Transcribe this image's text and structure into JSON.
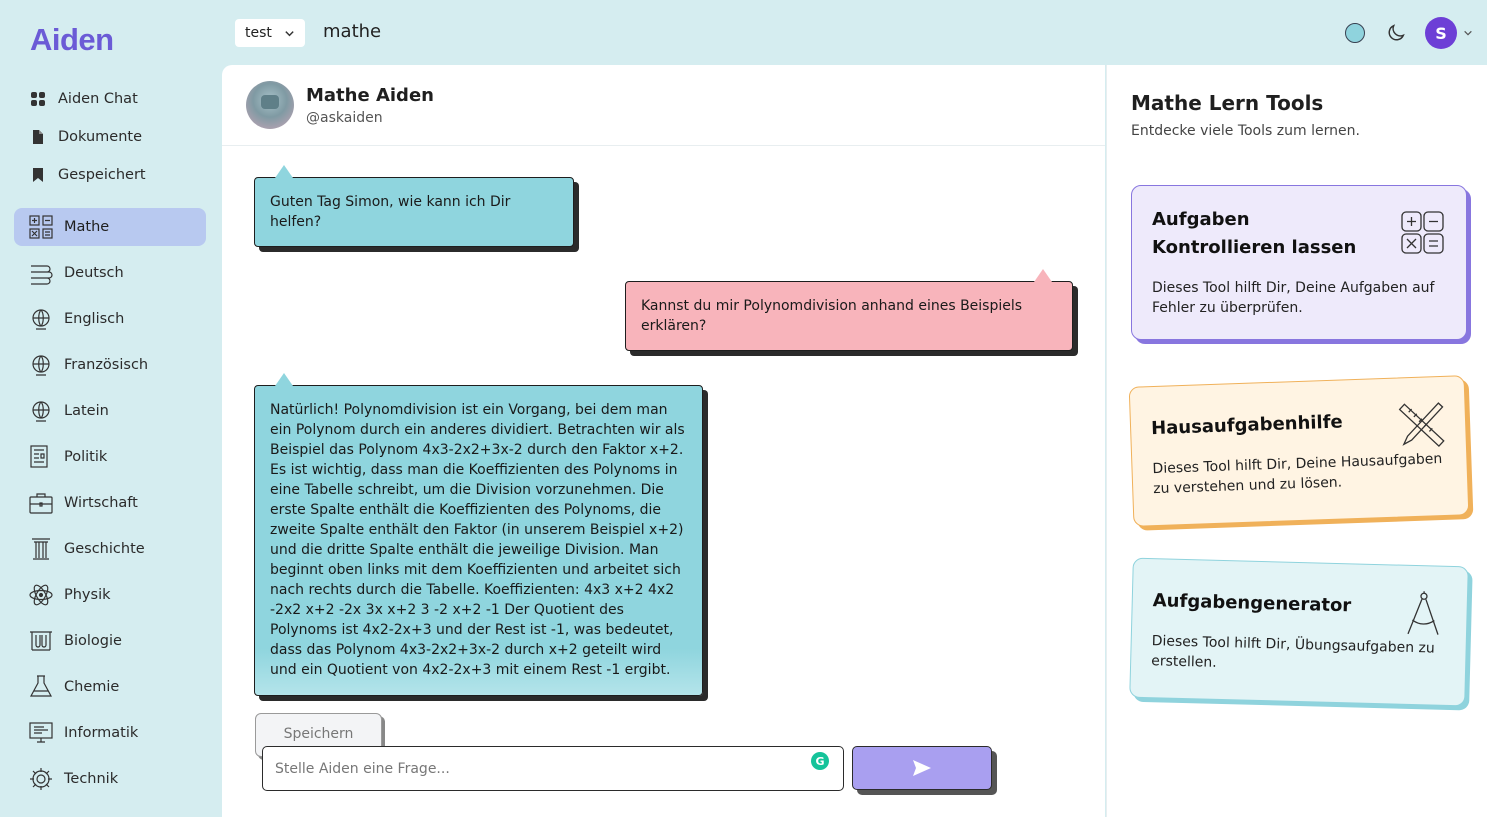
{
  "app": {
    "logo": "Aiden"
  },
  "topbar": {
    "workspace": "test",
    "page_title": "mathe",
    "user_initial": "S"
  },
  "sidebar": {
    "nav": [
      {
        "label": "Aiden Chat",
        "icon": "grid-icon"
      },
      {
        "label": "Dokumente",
        "icon": "document-icon"
      },
      {
        "label": "Gespeichert",
        "icon": "bookmark-icon"
      }
    ],
    "subjects": [
      {
        "label": "Mathe",
        "icon": "math-icon",
        "active": true
      },
      {
        "label": "Deutsch",
        "icon": "book-icon"
      },
      {
        "label": "Englisch",
        "icon": "globe-icon"
      },
      {
        "label": "Französisch",
        "icon": "globe-icon"
      },
      {
        "label": "Latein",
        "icon": "globe-icon"
      },
      {
        "label": "Politik",
        "icon": "newspaper-icon"
      },
      {
        "label": "Wirtschaft",
        "icon": "briefcase-icon"
      },
      {
        "label": "Geschichte",
        "icon": "column-icon"
      },
      {
        "label": "Physik",
        "icon": "atom-icon"
      },
      {
        "label": "Biologie",
        "icon": "lab-icon"
      },
      {
        "label": "Chemie",
        "icon": "flask-icon"
      },
      {
        "label": "Informatik",
        "icon": "monitor-icon"
      },
      {
        "label": "Technik",
        "icon": "gear-icon"
      }
    ]
  },
  "chat": {
    "bot_name": "Mathe Aiden",
    "bot_handle": "@askaiden",
    "messages": [
      {
        "role": "ai",
        "text": "Guten Tag Simon, wie kann ich Dir helfen?"
      },
      {
        "role": "user",
        "text": "Kannst du mir Polynomdivision anhand eines Beispiels erklären?"
      },
      {
        "role": "ai",
        "text": "Natürlich! Polynomdivision ist ein Vorgang, bei dem man ein Polynom durch ein anderes dividiert. Betrachten wir als Beispiel das Polynom 4x3-2x2+3x-2 durch den Faktor x+2. Es ist wichtig, dass man die Koeffizienten des Polynoms in eine Tabelle schreibt, um die Division vorzunehmen. Die erste Spalte enthält die Koeffizienten des Polynoms, die zweite Spalte enthält den Faktor (in unserem Beispiel x+2) und die dritte Spalte enthält die jeweilige Division. Man beginnt oben links mit dem Koeffizienten und arbeitet sich nach rechts durch die Tabelle. Koeffizienten: 4x3 x+2 4x2 -2x2 x+2 -2x 3x x+2 3 -2 x+2 -1 Der Quotient des Polynoms ist 4x2-2x+3 und der Rest ist -1, was bedeutet, dass das Polynom 4x3-2x2+3x-2 durch x+2 geteilt wird und ein Quotient von 4x2-2x+3 mit einem Rest -1 ergibt."
      }
    ],
    "save_label": "Speichern",
    "input_placeholder": "Stelle Aiden eine Frage..."
  },
  "tools": {
    "title": "Mathe Lern Tools",
    "subtitle": "Entdecke viele Tools zum lernen.",
    "cards": [
      {
        "title": "Aufgaben Kontrollieren lassen",
        "desc": "Dieses Tool hilft Dir, Deine Aufgaben auf Fehler zu überprüfen.",
        "icon": "calculator-icon",
        "color": "#8876df"
      },
      {
        "title": "Hausaufgabenhilfe",
        "desc": "Dieses Tool hilft Dir, Deine Hausaufgaben zu verstehen und zu lösen.",
        "icon": "ruler-pencil-icon",
        "color": "#f0b15a"
      },
      {
        "title": "Aufgabengenerator",
        "desc": "Dieses Tool hilft Dir, Übungsaufgaben zu erstellen.",
        "icon": "compass-icon",
        "color": "#8fd3dd"
      }
    ]
  },
  "colors": {
    "accent": "#6b5bd6",
    "ai_bubble": "#8fd5de",
    "user_bubble": "#f8b4bb",
    "send": "#a99ff0",
    "bg": "#d5edf0"
  }
}
